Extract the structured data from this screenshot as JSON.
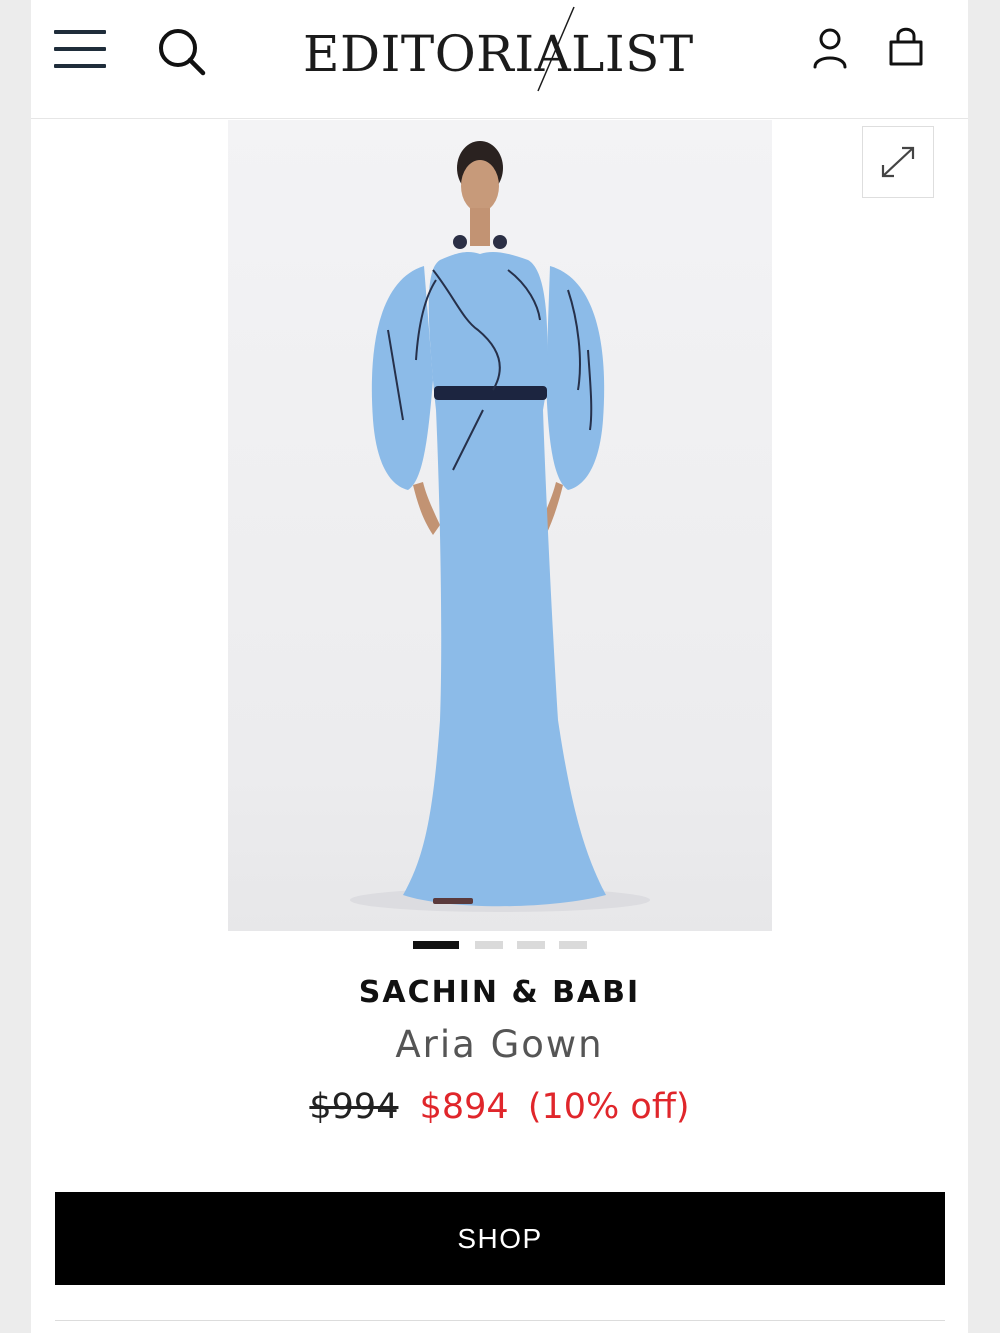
{
  "header": {
    "logo_text": "EDITORIALIST"
  },
  "product": {
    "brand": "SACHIN & BABI",
    "name": "Aria Gown",
    "original_price": "$994",
    "sale_price": "$894",
    "discount": "(10% off)",
    "image_count": 4,
    "active_image": 1,
    "colors": {
      "gown": "#8cbbe8",
      "belt": "#1c2540",
      "sale": "#e0262b"
    }
  },
  "actions": {
    "shop_label": "SHOP"
  },
  "icons": [
    "menu-icon",
    "search-icon",
    "account-icon",
    "bag-icon",
    "expand-icon"
  ]
}
